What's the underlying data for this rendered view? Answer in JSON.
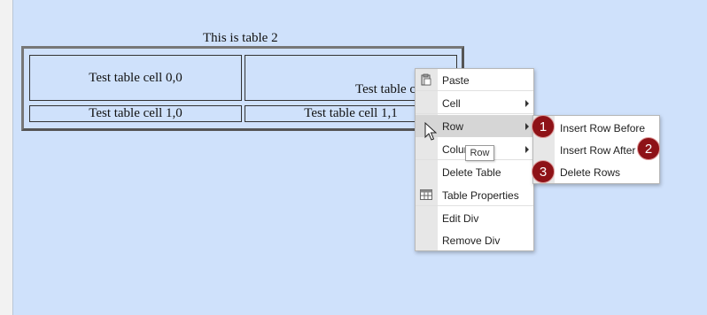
{
  "table": {
    "caption": "This is table 2",
    "rows": [
      [
        "Test table cell 0,0",
        "Test table cell 0,1"
      ],
      [
        "Test table cell 1,0",
        "Test table cell 1,1"
      ]
    ]
  },
  "context_menu": {
    "items": [
      {
        "label": "Paste",
        "icon": "paste-icon"
      },
      {
        "label": "Cell",
        "submenu": true
      },
      {
        "label": "Row",
        "submenu": true,
        "highlighted": true
      },
      {
        "label": "Column",
        "submenu": true
      },
      {
        "label": "Delete Table"
      },
      {
        "label": "Table Properties",
        "icon": "table-properties-icon"
      },
      {
        "label": "Edit Div"
      },
      {
        "label": "Remove Div"
      }
    ]
  },
  "row_submenu": {
    "items": [
      {
        "label": "Insert Row Before"
      },
      {
        "label": "Insert Row After"
      },
      {
        "label": "Delete Rows"
      }
    ]
  },
  "tooltip": "Row",
  "badges": [
    "1",
    "2",
    "3"
  ],
  "colors": {
    "badge": "#8e1217",
    "background": "#cfe1fb",
    "highlight": "#d6d6d6"
  }
}
